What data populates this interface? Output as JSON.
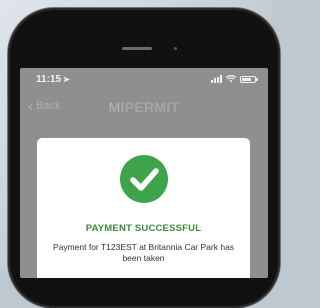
{
  "status_bar": {
    "time": "11:15"
  },
  "nav": {
    "back_label": "Back",
    "title_prefix": "MI",
    "title_main": "PERMIT"
  },
  "modal": {
    "title": "PAYMENT SUCCESSFUL",
    "message": "Payment for T123EST at Britannia Car Park has been taken"
  },
  "colors": {
    "success_green": "#3ea34a",
    "title_green": "#3a8a3f",
    "dim_overlay": "#8f8f8f"
  },
  "icons": [
    "location-arrow-icon",
    "signal-icon",
    "wifi-icon",
    "battery-icon",
    "back-chevron-icon",
    "checkmark-icon"
  ]
}
